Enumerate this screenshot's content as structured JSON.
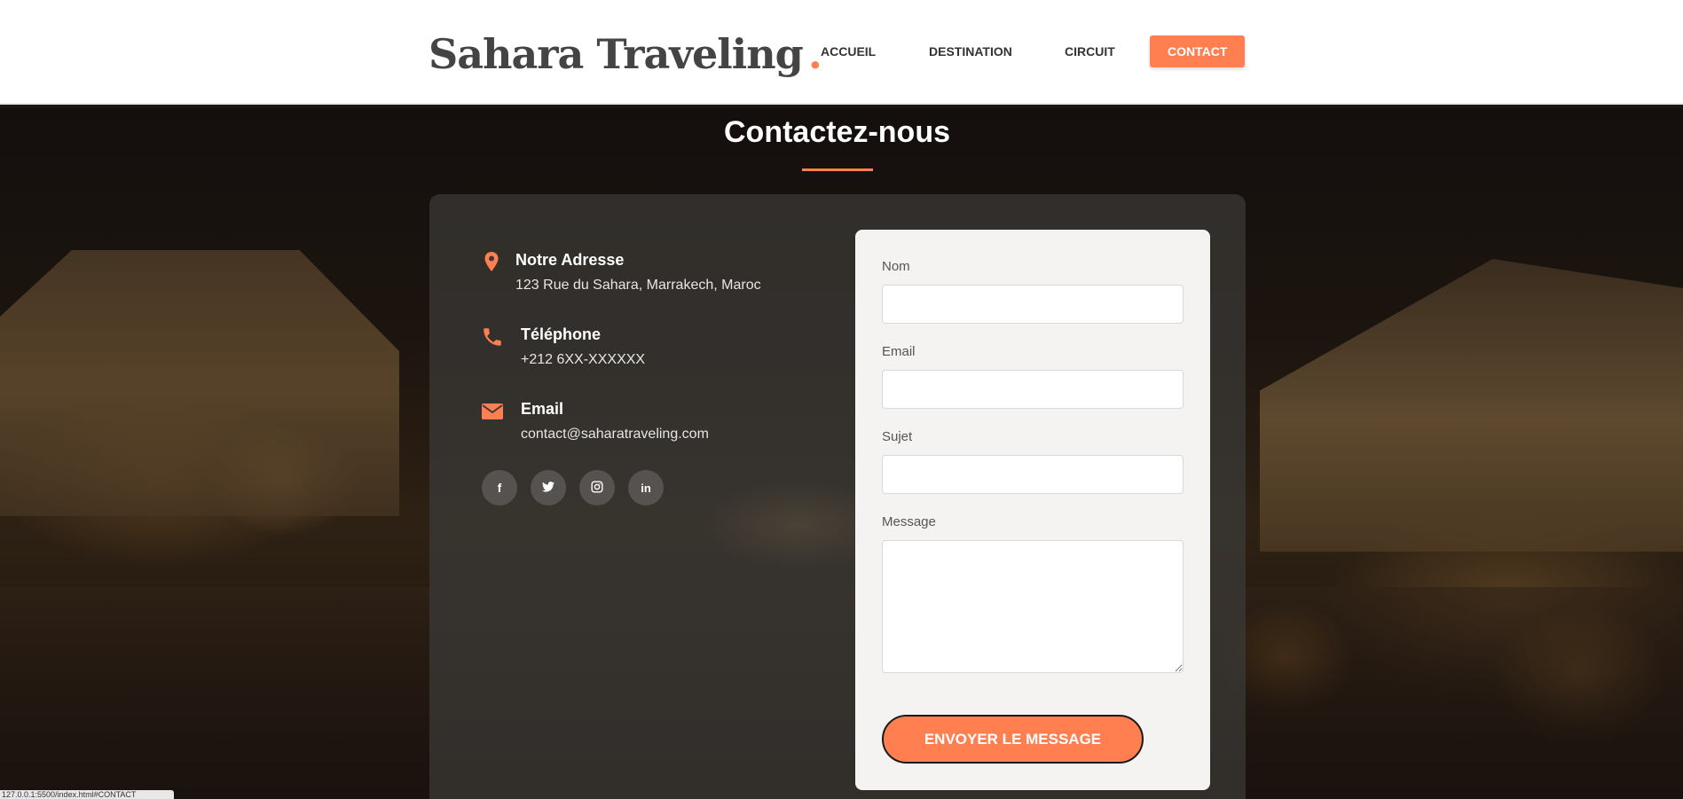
{
  "header": {
    "logo_text": "Sahara Traveling",
    "logo_dot": ".",
    "nav": [
      "ACCUEIL",
      "DESTINATION",
      "CIRCUIT",
      "CONTACT"
    ],
    "active_nav": "CONTACT"
  },
  "section": {
    "title": "Contactez-nous"
  },
  "contact_info": {
    "address": {
      "label": "Notre Adresse",
      "value": "123 Rue du Sahara, Marrakech, Maroc",
      "icon": "map-marker-icon"
    },
    "phone": {
      "label": "Téléphone",
      "value": "+212 6XX-XXXXXX",
      "icon": "phone-icon"
    },
    "email": {
      "label": "Email",
      "value": "contact@saharatraveling.com",
      "icon": "envelope-icon"
    }
  },
  "social": [
    {
      "name": "facebook",
      "glyph": "f"
    },
    {
      "name": "twitter",
      "glyph": "t"
    },
    {
      "name": "instagram",
      "glyph": "◎"
    },
    {
      "name": "linkedin",
      "glyph": "in"
    }
  ],
  "form": {
    "name_label": "Nom",
    "name_value": "",
    "email_label": "Email",
    "email_value": "",
    "subject_label": "Sujet",
    "subject_value": "",
    "message_label": "Message",
    "message_value": "",
    "submit_label": "ENVOYER LE MESSAGE"
  },
  "status_bar": {
    "text": "127.0.0.1:5500/index.html#CONTACT"
  },
  "colors": {
    "accent": "#ff7f50",
    "header_bg": "#ffffff",
    "card_bg": "#3c3a38",
    "form_bg": "#f4f3f2"
  }
}
